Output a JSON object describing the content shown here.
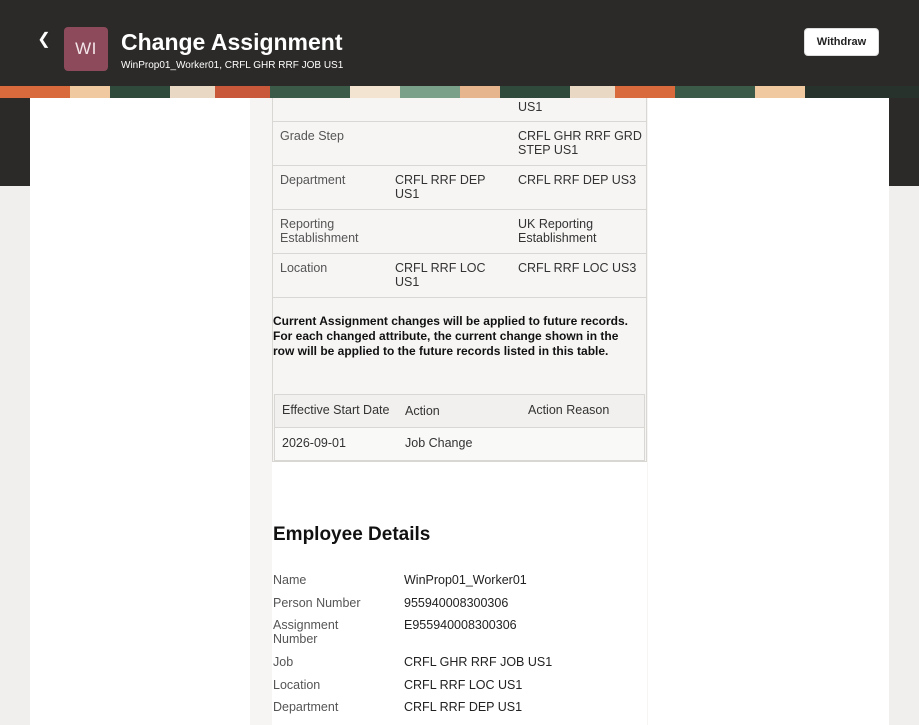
{
  "header": {
    "avatar_initials": "WI",
    "title": "Change Assignment",
    "subtitle": "WinProp01_Worker01, CRFL GHR RRF JOB US1",
    "withdraw_label": "Withdraw"
  },
  "comparison_rows": [
    {
      "attribute": "",
      "current": "",
      "future": "US1"
    },
    {
      "attribute": "Grade Step",
      "current": "",
      "future": "CRFL GHR RRF GRD STEP US1"
    },
    {
      "attribute": "Department",
      "current": "CRFL RRF DEP US1",
      "future": "CRFL RRF DEP US3"
    },
    {
      "attribute": "Reporting Establishment",
      "current": "",
      "future": "UK Reporting Establishment"
    },
    {
      "attribute": "Location",
      "current": "CRFL RRF LOC US1",
      "future": "CRFL RRF LOC US3"
    }
  ],
  "notice": {
    "line1": "Current Assignment changes will be applied to future records.",
    "line2": "For each changed attribute, the current change shown in the row will be applied to the future records listed in this table."
  },
  "future_records": {
    "headers": [
      "Effective Start Date",
      "Action",
      "Action Reason"
    ],
    "rows": [
      {
        "effective_start_date": "2026-09-01",
        "action": "Job Change",
        "action_reason": ""
      }
    ]
  },
  "employee_details": {
    "title": "Employee Details",
    "fields": [
      {
        "label": "Name",
        "value": "WinProp01_Worker01"
      },
      {
        "label": "Person Number",
        "value": "955940008300306"
      },
      {
        "label": "Assignment Number",
        "value": "E955940008300306"
      },
      {
        "label": "Job",
        "value": "CRFL GHR RRF JOB US1"
      },
      {
        "label": "Location",
        "value": "CRFL RRF LOC US1"
      },
      {
        "label": "Department",
        "value": "CRFL RRF DEP US1"
      }
    ]
  }
}
